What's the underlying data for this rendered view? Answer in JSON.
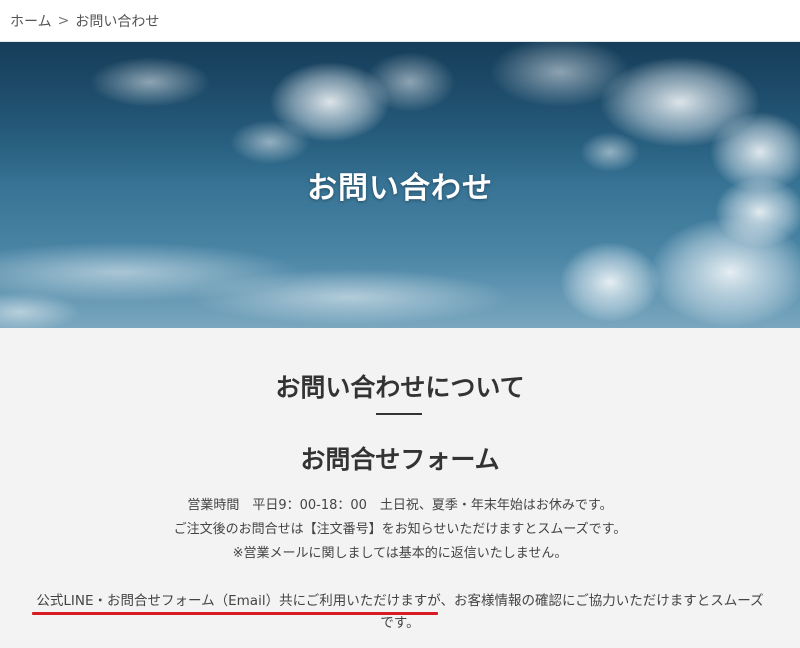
{
  "breadcrumb": {
    "home": "ホーム",
    "separator": ">",
    "current": "お問い合わせ"
  },
  "hero": {
    "title": "お問い合わせ"
  },
  "content": {
    "about_heading": "お問い合わせについて",
    "form_heading": "お問合せフォーム",
    "hours": "営業時間　平日9：00-18：00　土日祝、夏季・年末年始はお休みです。",
    "order_note": "ご注文後のお問合せは【注文番号】をお知らせいただけますとスムーズです。",
    "sales_mail_note": "※営業メールに関しましては基本的に返信いたしません。",
    "contact_note_highlight": "公式LINE・お問合せフォーム（Email）共にご利用いただけますが、",
    "contact_note_rest": "お客様情報の確認にご協力いただけますとスムーズです。"
  },
  "colors": {
    "highlight_underline": "#d91c24",
    "background": "#f3f3f3"
  }
}
